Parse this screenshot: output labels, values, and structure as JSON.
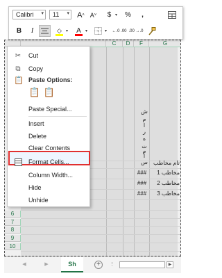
{
  "mini_toolbar": {
    "font_name": "Calibri",
    "font_size": "11",
    "grow_font": "A",
    "shrink_font": "A",
    "currency": "$",
    "percent": "%",
    "comma": ",",
    "bold": "B",
    "italic": "I",
    "font_color_letter": "A",
    "increase_decimal": "←.0 .00",
    "decrease_decimal": ".00 →.0",
    "fill_color": "#ffff00",
    "font_color": "#ff0000"
  },
  "sheet": {
    "columns": [
      "C",
      "D",
      "F",
      "G"
    ],
    "rows": [
      "6",
      "7",
      "8",
      "9",
      "10"
    ],
    "vertical_chars": [
      "ش",
      "م",
      "ا",
      "ر",
      "ه",
      "ت",
      "م",
      "ا",
      "س"
    ],
    "header_cell": "تام مخاطب",
    "contacts": [
      "مخاطب 1",
      "مخاطب 2",
      "مخاطب 3"
    ],
    "hash_values": [
      "###",
      "###",
      "###"
    ]
  },
  "context_menu": {
    "cut": "Cut",
    "copy": "Copy",
    "paste_options": "Paste Options:",
    "paste_special": "Paste Special...",
    "insert": "Insert",
    "delete": "Delete",
    "clear_contents": "Clear Contents",
    "format_cells": "Format Cells...",
    "column_width": "Column Width...",
    "hide": "Hide",
    "unhide": "Unhide"
  },
  "tab_bar": {
    "sheet_tab": "Sh",
    "add_sheet": "+"
  },
  "colors": {
    "accent": "#217346",
    "highlight_border": "#e03030"
  }
}
